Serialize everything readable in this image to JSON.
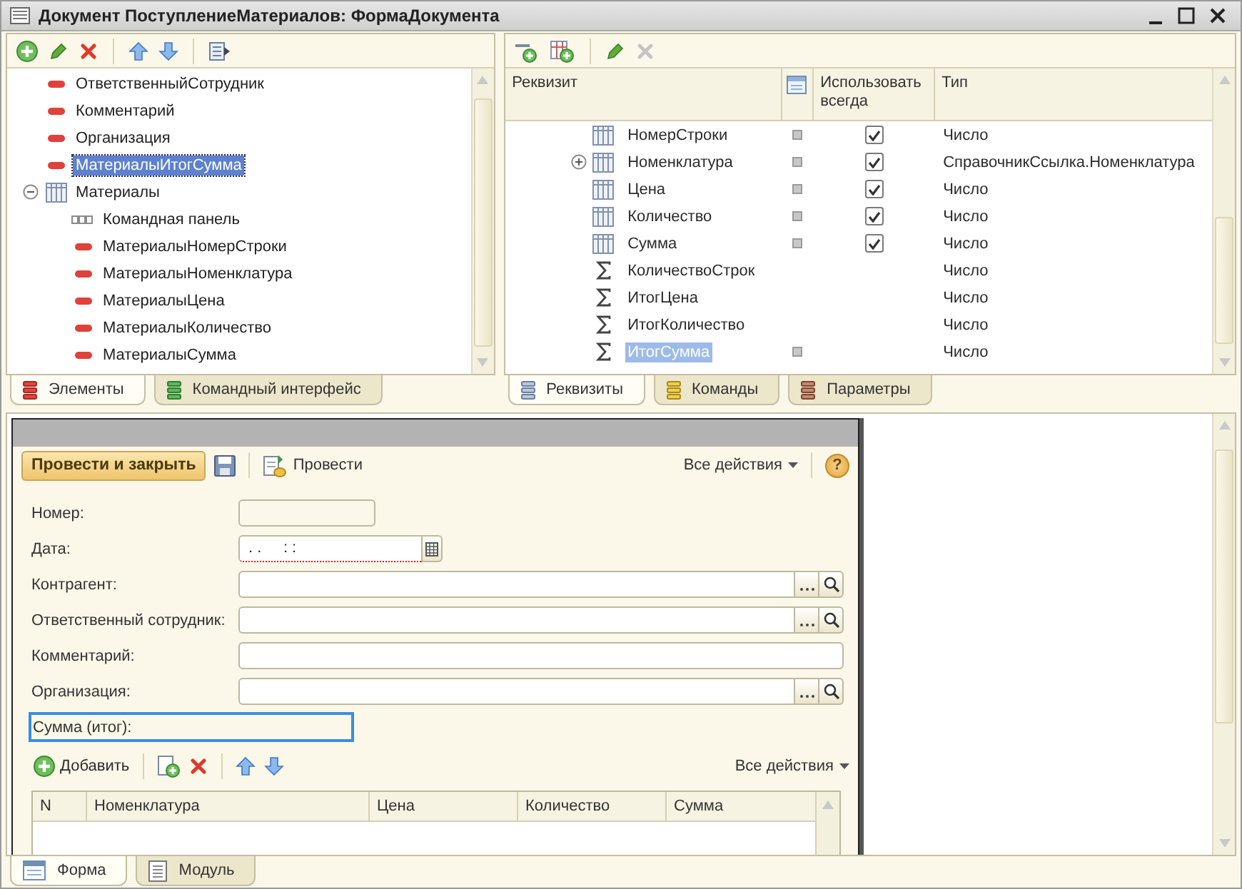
{
  "window": {
    "title": "Документ ПоступлениеМатериалов: ФормаДокумента"
  },
  "elements_panel": {
    "tree": [
      {
        "label": "ОтветственныйСотрудник",
        "kind": "field",
        "selected": false
      },
      {
        "label": "Комментарий",
        "kind": "field",
        "selected": false
      },
      {
        "label": "Организация",
        "kind": "field",
        "selected": false
      },
      {
        "label": "МатериалыИтогСумма",
        "kind": "field",
        "selected": true
      },
      {
        "label": "Материалы",
        "kind": "table",
        "selected": false,
        "expanded": true,
        "children": [
          {
            "label": "Командная панель",
            "kind": "command_bar",
            "selected": false
          },
          {
            "label": "МатериалыНомерСтроки",
            "kind": "field",
            "selected": false
          },
          {
            "label": "МатериалыНоменклатура",
            "kind": "field",
            "selected": false
          },
          {
            "label": "МатериалыЦена",
            "kind": "field",
            "selected": false
          },
          {
            "label": "МатериалыКоличество",
            "kind": "field",
            "selected": false
          },
          {
            "label": "МатериалыСумма",
            "kind": "field",
            "selected": false
          }
        ]
      }
    ],
    "tabs": [
      {
        "label": "Элементы",
        "selected": true
      },
      {
        "label": "Командный интерфейс",
        "selected": false
      }
    ]
  },
  "attributes_panel": {
    "columns": [
      "Реквизит",
      "Использовать всегда",
      "Тип"
    ],
    "rows": [
      {
        "name": "НомерСтроки",
        "kind": "column",
        "expandable": false,
        "flag": true,
        "use_always": true,
        "type": "Число",
        "selected": false
      },
      {
        "name": "Номенклатура",
        "kind": "column",
        "expandable": true,
        "flag": true,
        "use_always": true,
        "type": "СправочникСсылка.Номенклатура",
        "selected": false
      },
      {
        "name": "Цена",
        "kind": "column",
        "expandable": false,
        "flag": true,
        "use_always": true,
        "type": "Число",
        "selected": false
      },
      {
        "name": "Количество",
        "kind": "column",
        "expandable": false,
        "flag": true,
        "use_always": true,
        "type": "Число",
        "selected": false
      },
      {
        "name": "Сумма",
        "kind": "column",
        "expandable": false,
        "flag": true,
        "use_always": true,
        "type": "Число",
        "selected": false
      },
      {
        "name": "КоличествоСтрок",
        "kind": "total",
        "expandable": false,
        "flag": false,
        "use_always": false,
        "type": "Число",
        "selected": false
      },
      {
        "name": "ИтогЦена",
        "kind": "total",
        "expandable": false,
        "flag": false,
        "use_always": false,
        "type": "Число",
        "selected": false
      },
      {
        "name": "ИтогКоличество",
        "kind": "total",
        "expandable": false,
        "flag": false,
        "use_always": false,
        "type": "Число",
        "selected": false
      },
      {
        "name": "ИтогСумма",
        "kind": "total",
        "expandable": false,
        "flag": true,
        "use_always": false,
        "type": "Число",
        "selected": true
      }
    ],
    "tabs": [
      {
        "label": "Реквизиты",
        "selected": true
      },
      {
        "label": "Команды",
        "selected": false
      },
      {
        "label": "Параметры",
        "selected": false
      }
    ]
  },
  "form": {
    "toolbar": {
      "post_and_close": "Провести и закрыть",
      "post": "Провести",
      "all_actions": "Все действия",
      "help": "?"
    },
    "fields": [
      {
        "label": "Номер:",
        "kind": "short",
        "selected": false
      },
      {
        "label": "Дата:",
        "kind": "date",
        "value": ". .     : :",
        "selected": false
      },
      {
        "label": "Контрагент:",
        "kind": "reference",
        "selected": false
      },
      {
        "label": "Ответственный сотрудник:",
        "kind": "reference",
        "selected": false
      },
      {
        "label": "Комментарий:",
        "kind": "text",
        "selected": false
      },
      {
        "label": "Организация:",
        "kind": "reference",
        "selected": false
      },
      {
        "label": "Сумма (итог):",
        "kind": "label",
        "selected": true
      }
    ],
    "table": {
      "toolbar": {
        "add": "Добавить",
        "all_actions": "Все действия"
      },
      "columns": [
        "N",
        "Номенклатура",
        "Цена",
        "Количество",
        "Сумма"
      ]
    }
  },
  "bottom_tabs": [
    {
      "label": "Форма",
      "selected": true
    },
    {
      "label": "Модуль",
      "selected": false
    }
  ]
}
